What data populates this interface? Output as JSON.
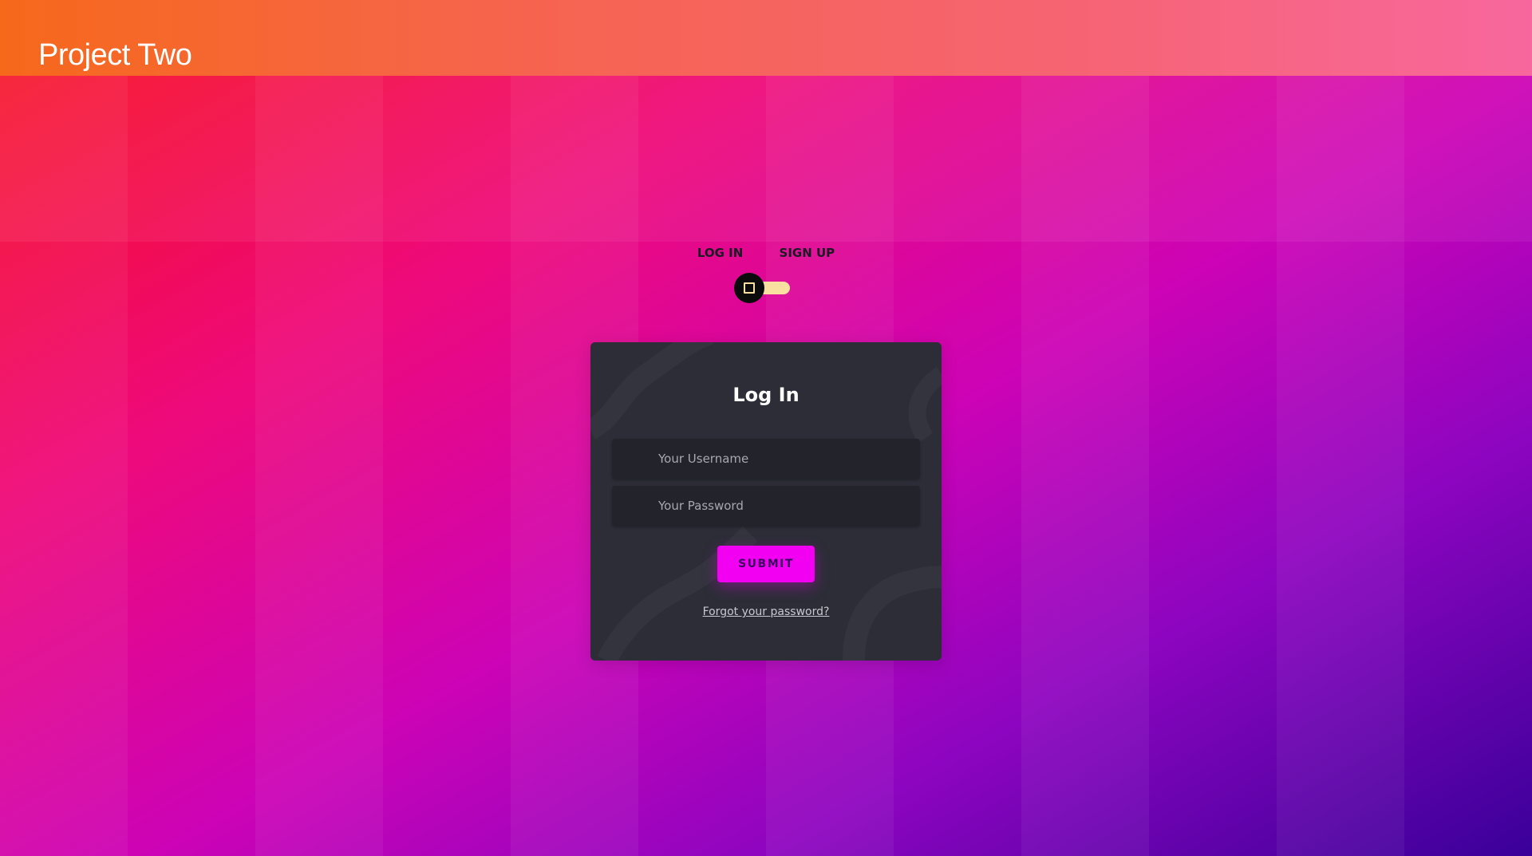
{
  "header": {
    "title": "Project Two"
  },
  "auth_tabs": {
    "login_label": "LOG IN",
    "signup_label": "SIGN UP"
  },
  "toggle": {
    "state": "off"
  },
  "login_card": {
    "title": "Log In",
    "username_placeholder": "Your Username",
    "password_placeholder": "Your Password",
    "submit_label": "SUBMIT",
    "forgot_link": "Forgot your password?"
  },
  "colors": {
    "header_gradient_start": "#f6691b",
    "header_gradient_end": "#f8679d",
    "card_bg": "#2c2d37",
    "input_bg": "#22232b",
    "submit_bg": "#f200f2",
    "toggle_track": "#f9dfa0",
    "toggle_knob": "#0c0b0b"
  }
}
